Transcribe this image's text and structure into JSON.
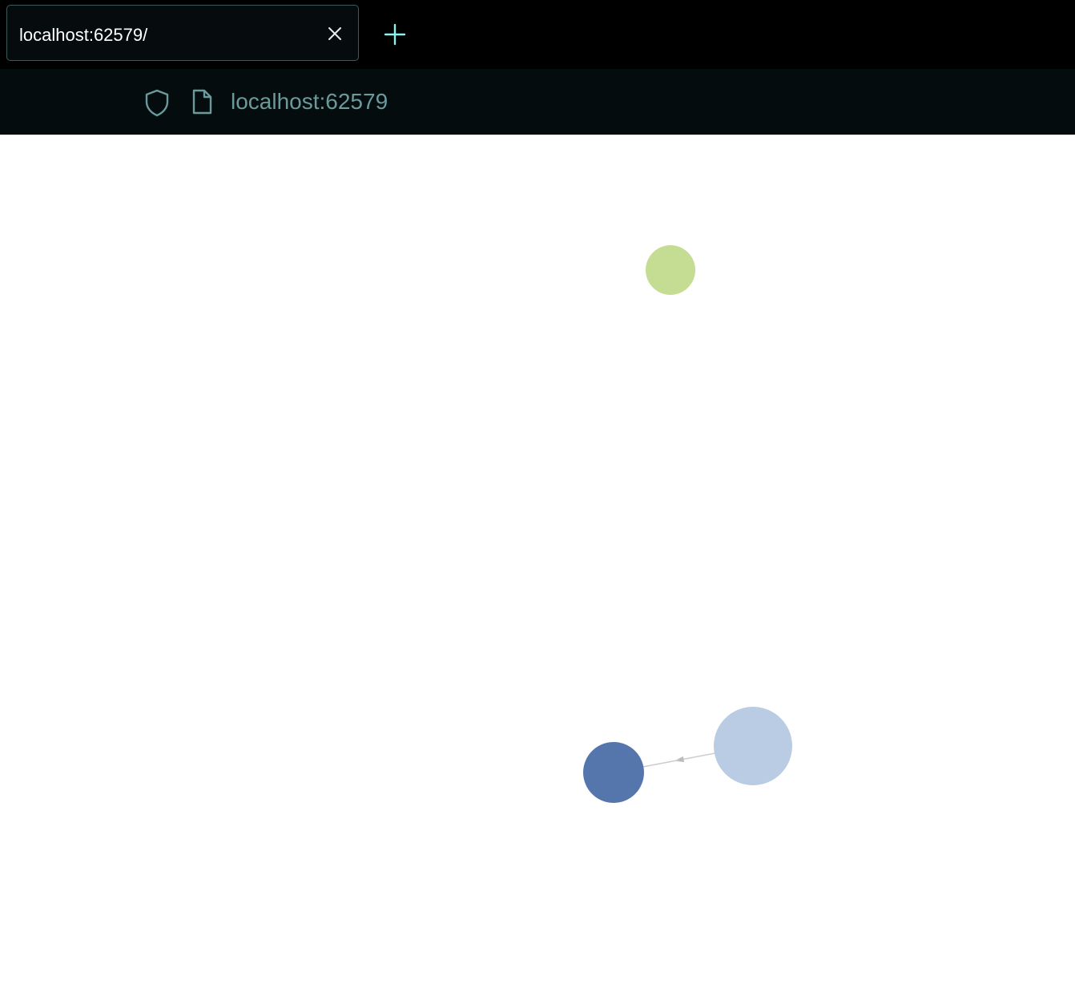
{
  "browser": {
    "tab": {
      "title": "localhost:62579/",
      "close_icon": "close-icon"
    },
    "new_tab_icon": "plus-icon",
    "address_bar": {
      "security_icon": "shield-icon",
      "page_icon": "document-icon",
      "url": "localhost:62579"
    }
  },
  "graph": {
    "nodes": [
      {
        "id": "node-1",
        "color": "#c5dd93"
      },
      {
        "id": "node-2",
        "color": "#b9cce3"
      },
      {
        "id": "node-3",
        "color": "#5576ad"
      }
    ],
    "edges": [
      {
        "from": "node-2",
        "to": "node-3",
        "color": "#cccccc",
        "directed": true
      }
    ]
  }
}
